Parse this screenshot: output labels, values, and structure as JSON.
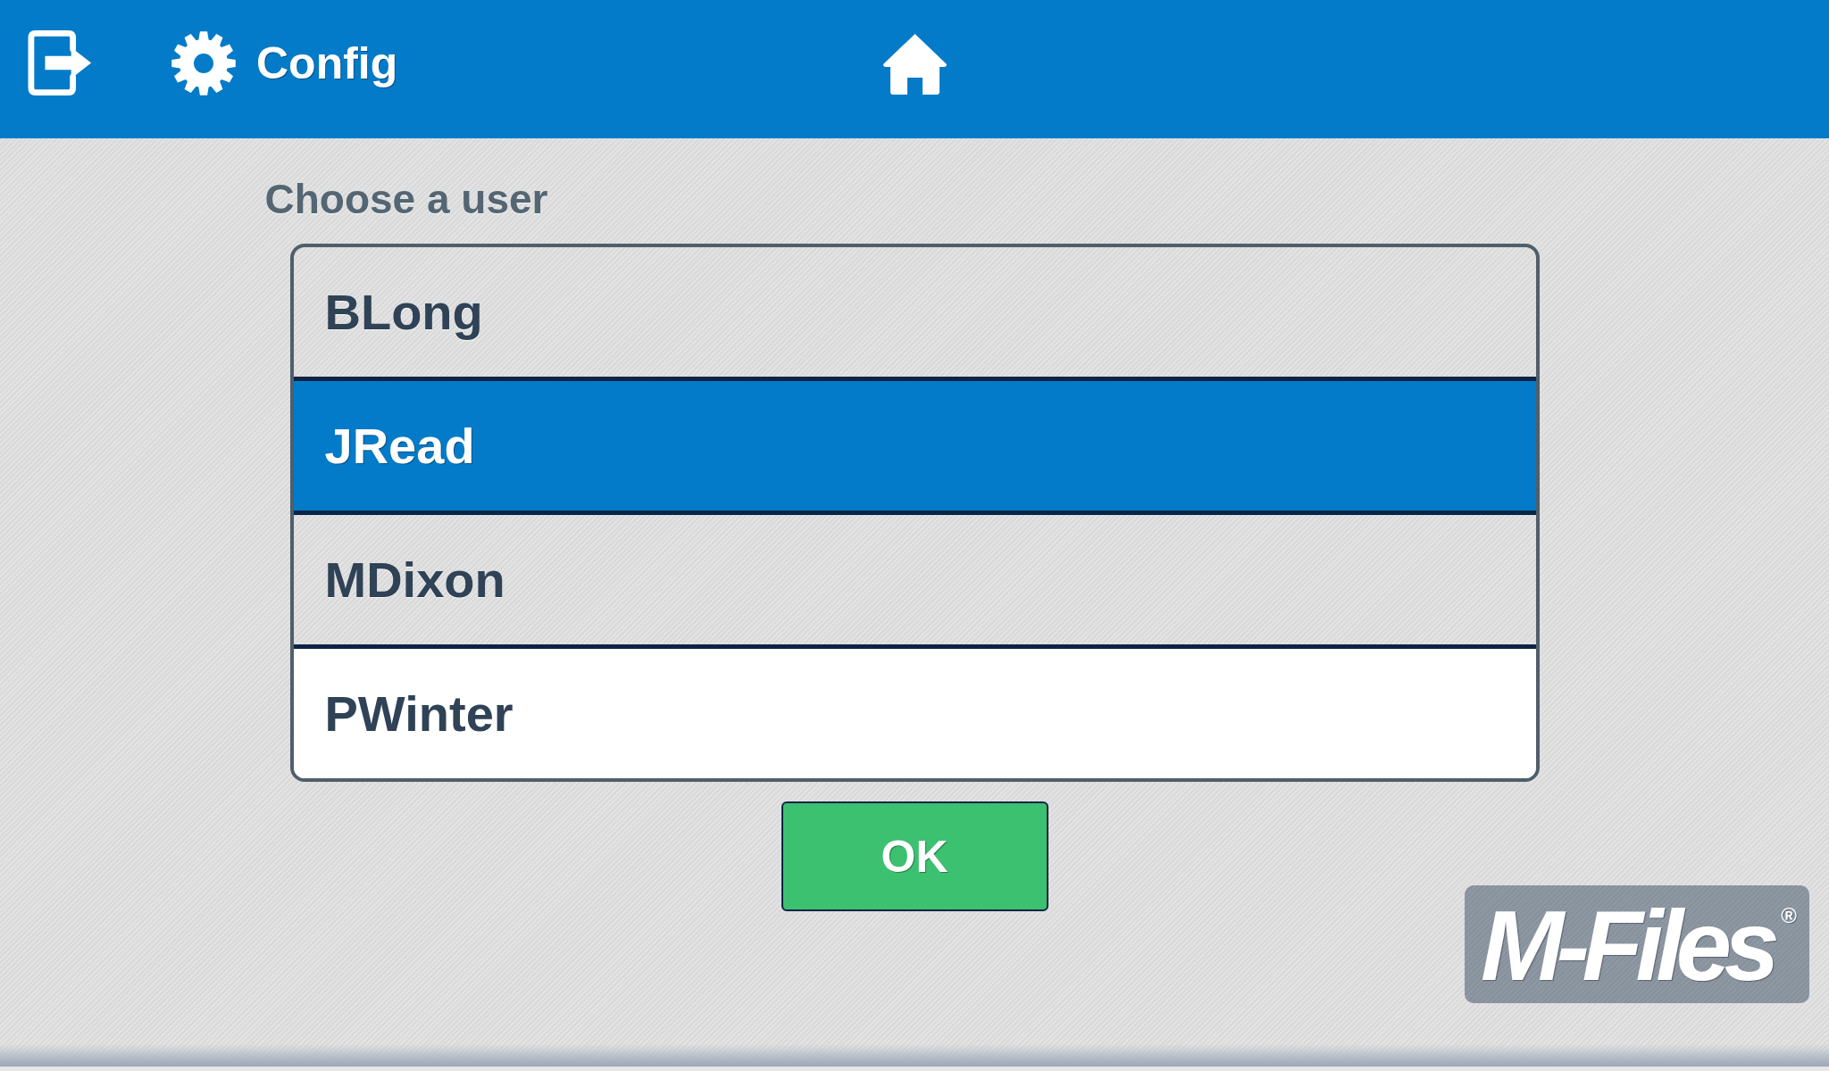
{
  "header": {
    "config_label": "Config"
  },
  "prompt": "Choose a user",
  "users": [
    {
      "name": "BLong",
      "selected": false,
      "highlighted": false
    },
    {
      "name": "JRead",
      "selected": true,
      "highlighted": false
    },
    {
      "name": "MDixon",
      "selected": false,
      "highlighted": false
    },
    {
      "name": "PWinter",
      "selected": false,
      "highlighted": true
    }
  ],
  "ok_button": "OK",
  "logo": {
    "text": "M-Files",
    "mark": "®"
  }
}
